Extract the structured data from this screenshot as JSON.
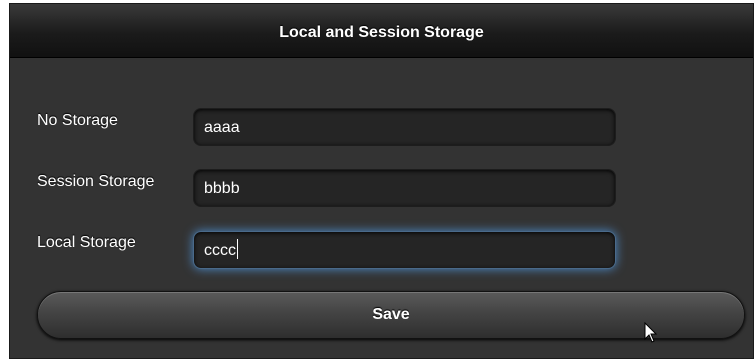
{
  "header": {
    "title": "Local and Session Storage"
  },
  "form": {
    "rows": [
      {
        "label": "No Storage",
        "value": "aaaa"
      },
      {
        "label": "Session Storage",
        "value": "bbbb"
      },
      {
        "label": "Local Storage",
        "value": "cccc"
      }
    ],
    "save_label": "Save"
  },
  "icons": {
    "cursor": "mouse-pointer-icon"
  },
  "colors": {
    "background": "#333333",
    "header": "#1b1b1b",
    "input": "#252525",
    "focus_glow": "#4d8bc9",
    "text": "#ffffff"
  }
}
